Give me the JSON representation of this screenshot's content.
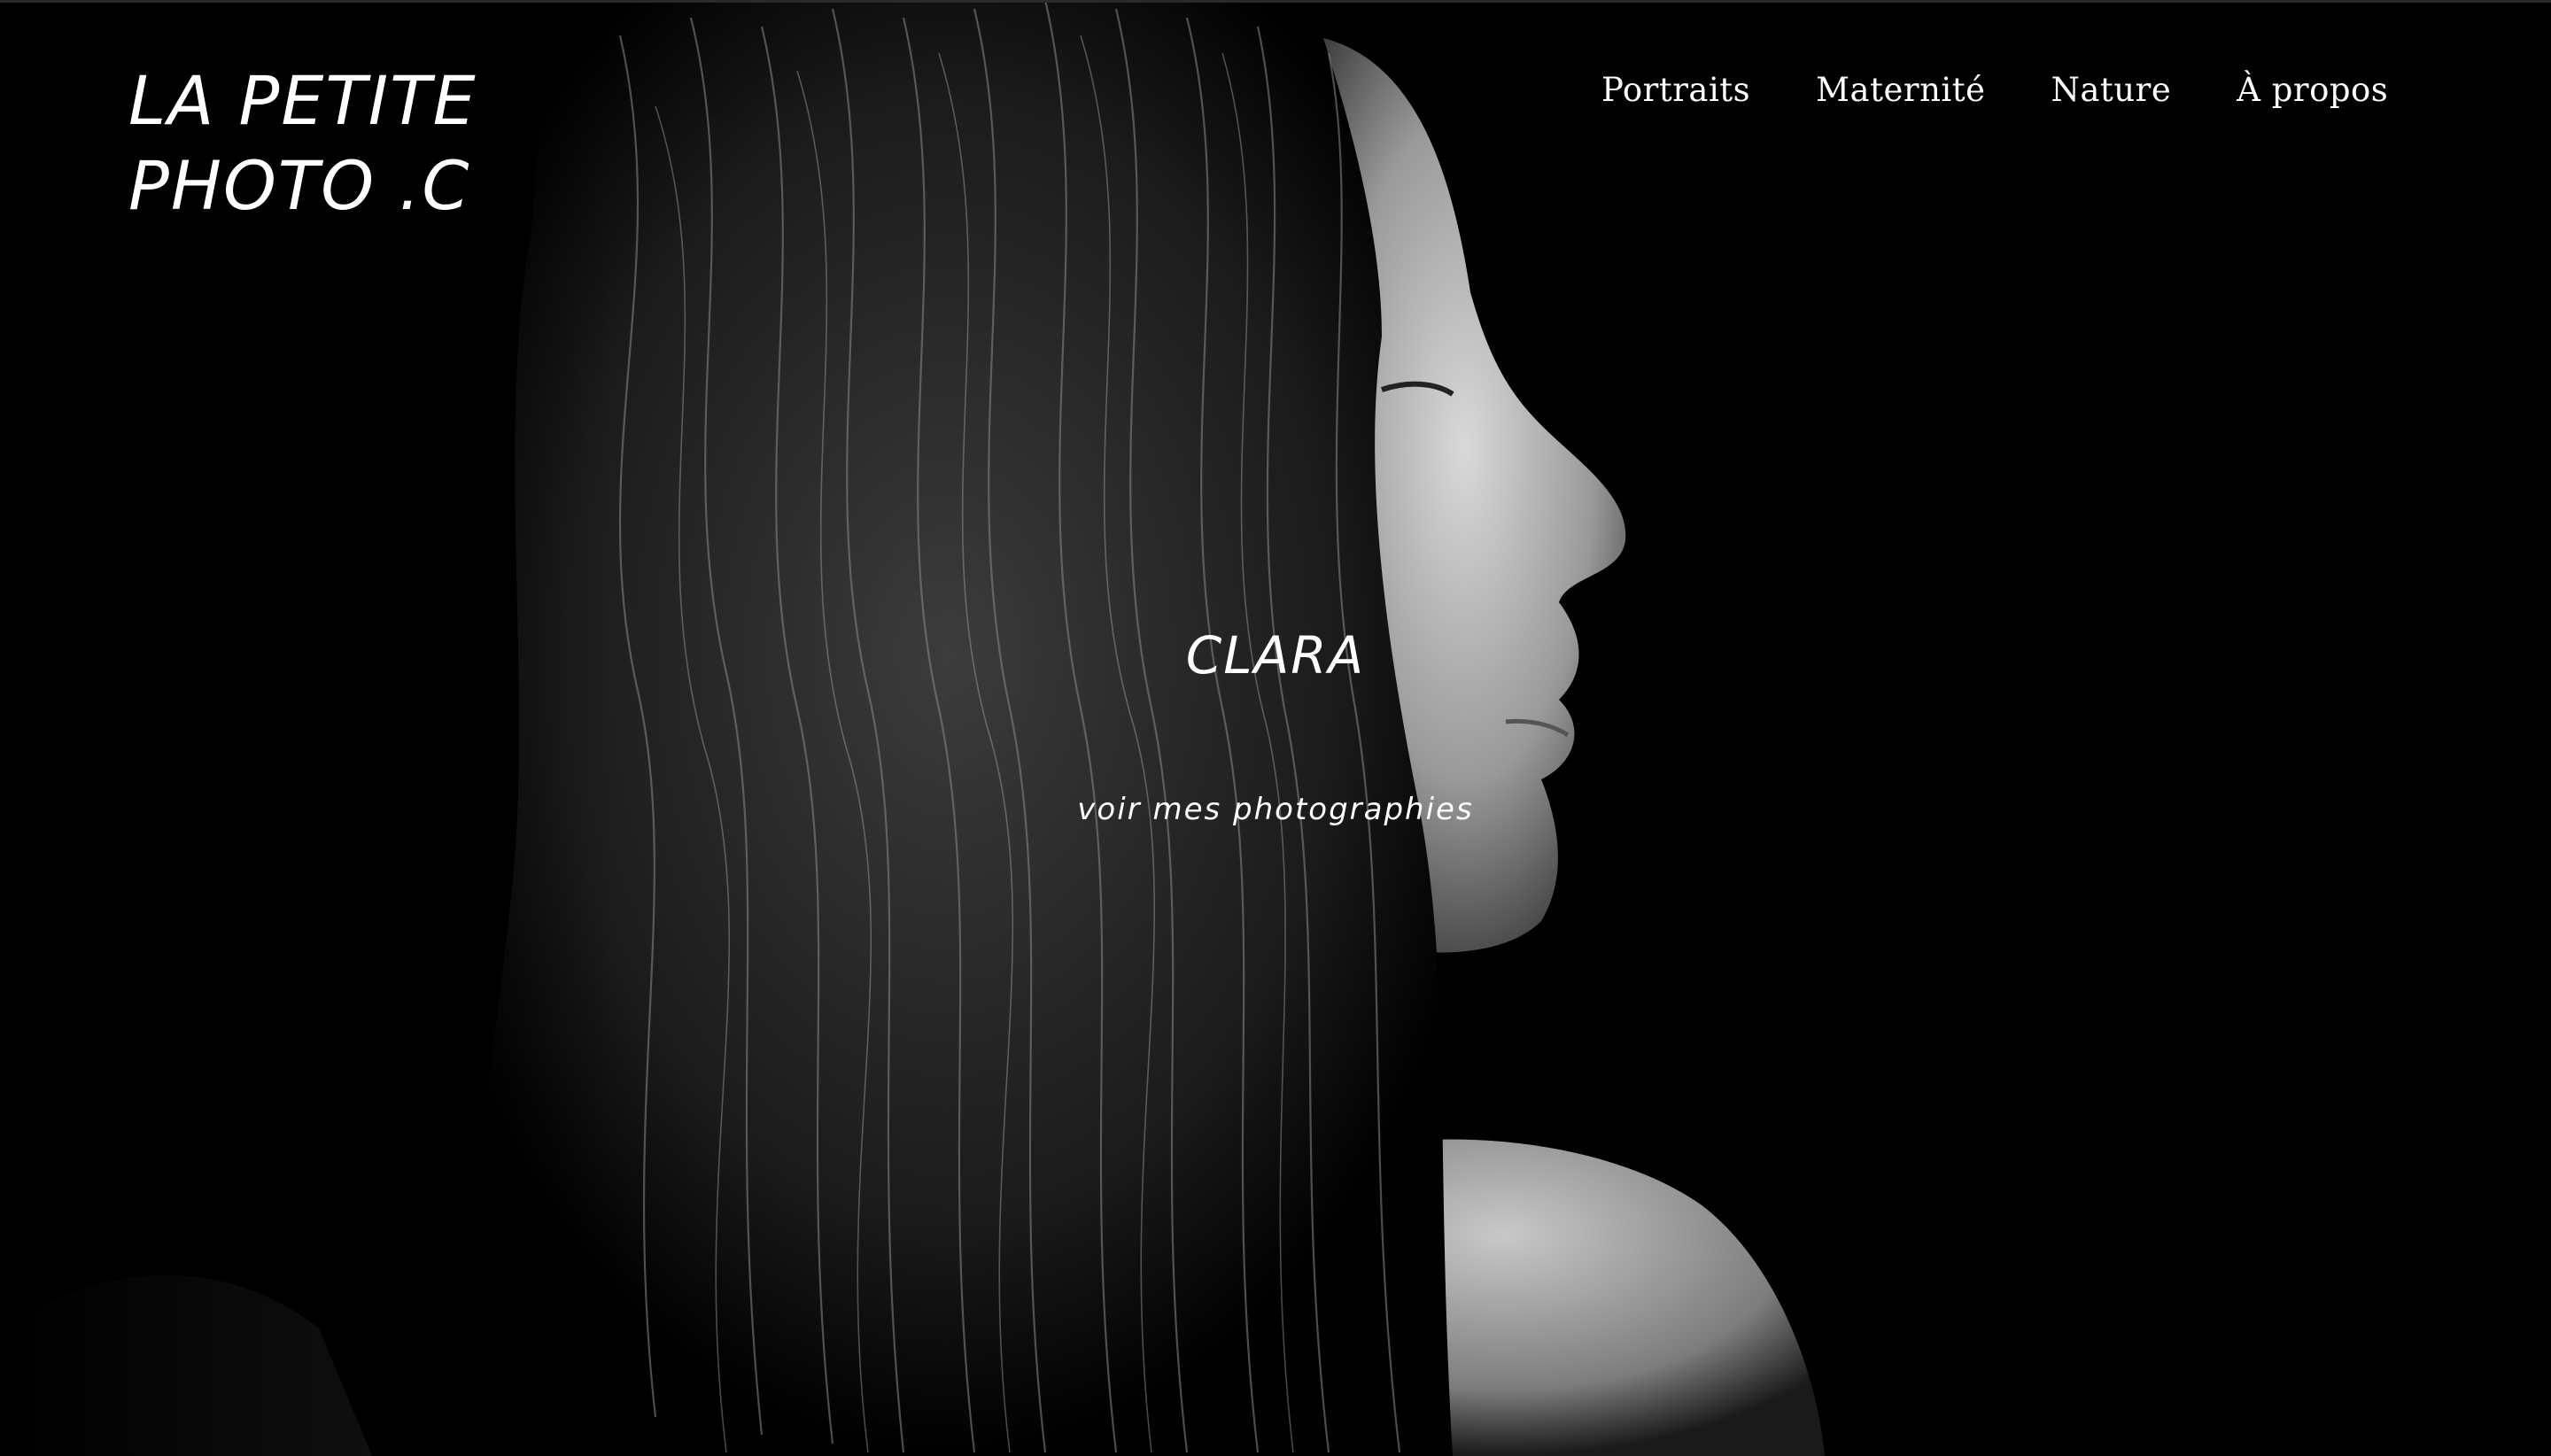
{
  "site": {
    "logo_line1": "LA PETITE",
    "logo_line2": "PHOTO .C"
  },
  "nav": {
    "items": [
      {
        "label": "Portraits"
      },
      {
        "label": "Maternité"
      },
      {
        "label": "Nature"
      },
      {
        "label": "À propos"
      }
    ]
  },
  "hero": {
    "title": "CLARA",
    "cta_label": "voir mes photographies",
    "image": "black-and-white-portrait-profile"
  },
  "colors": {
    "background": "#000000",
    "text": "#ffffff"
  }
}
